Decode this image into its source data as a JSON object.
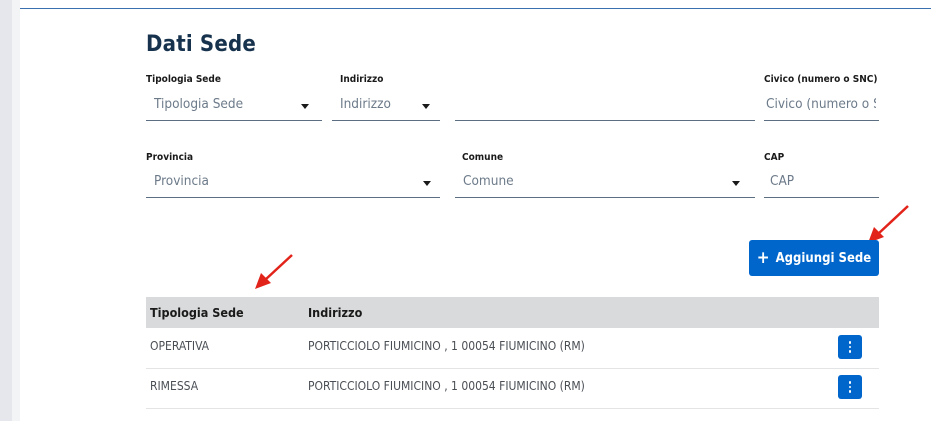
{
  "section_title": "Dati Sede",
  "fields": {
    "tipologia": {
      "label": "Tipologia Sede",
      "placeholder": "Tipologia Sede"
    },
    "indirizzo": {
      "label": "Indirizzo",
      "placeholder": "Indirizzo",
      "detail_value": ""
    },
    "civico": {
      "label": "Civico (numero o SNC)",
      "placeholder": "Civico (numero o SN"
    },
    "provincia": {
      "label": "Provincia",
      "placeholder": "Provincia"
    },
    "comune": {
      "label": "Comune",
      "placeholder": "Comune"
    },
    "cap": {
      "label": "CAP",
      "placeholder": "CAP"
    }
  },
  "add_button": {
    "icon": "plus-icon",
    "label": "Aggiungi Sede"
  },
  "table": {
    "headers": [
      "Tipologia Sede",
      "Indirizzo"
    ],
    "rows": [
      {
        "tipologia": "OPERATIVA",
        "indirizzo": "PORTICCIOLO FIUMICINO , 1 00054 FIUMICINO (RM)"
      },
      {
        "tipologia": "RIMESSA",
        "indirizzo": "PORTICCIOLO FIUMICINO , 1 00054 FIUMICINO (RM)"
      }
    ]
  },
  "colors": {
    "primary": "#0066cc",
    "title": "#17324d",
    "table_header_bg": "#d9dadb",
    "annotation_arrow": "#e2231a"
  }
}
